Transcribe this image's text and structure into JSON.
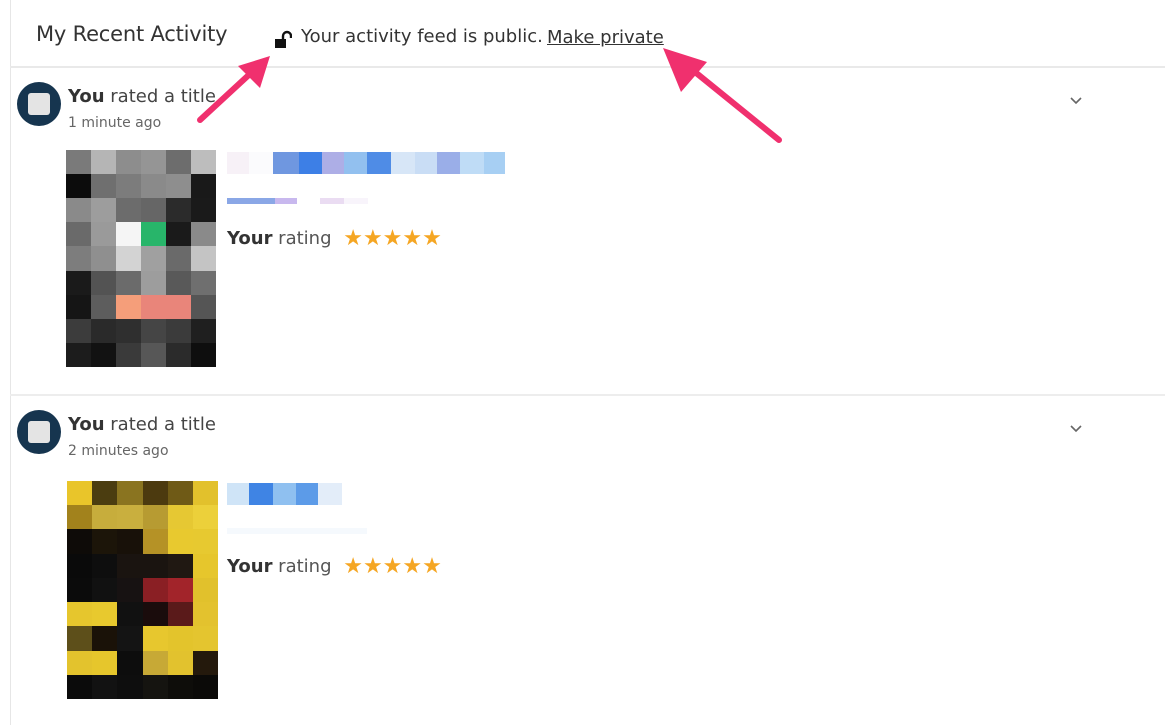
{
  "header": {
    "title": "My Recent Activity",
    "privacy_text": "Your activity feed is public.",
    "make_private_label": "Make private"
  },
  "activities": [
    {
      "title_bold": "You",
      "title_rest": " rated a title",
      "time": "1 minute ago",
      "rating_bold": "Your",
      "rating_rest": " rating",
      "stars": "★★★★★",
      "rating_value": 5
    },
    {
      "title_bold": "You",
      "title_rest": " rated a title",
      "time": "2 minutes ago",
      "rating_bold": "Your",
      "rating_rest": " rating",
      "stars": "★★★★★",
      "rating_value": 5
    }
  ],
  "colors": {
    "star": "#f5a623",
    "annotation_arrow": "#f0306e",
    "avatar": "#16354f"
  }
}
